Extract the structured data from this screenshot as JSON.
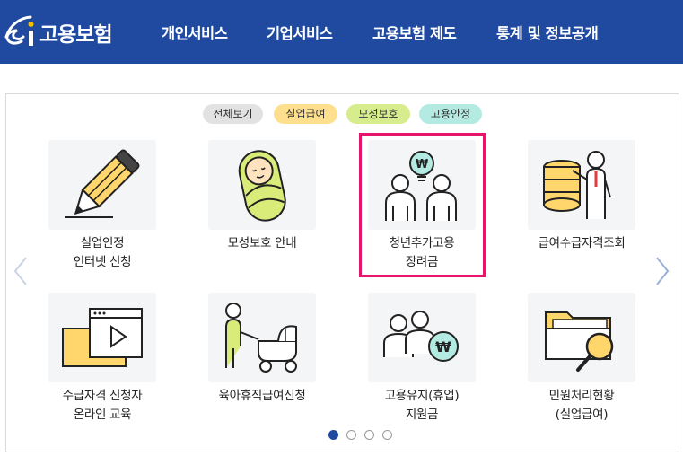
{
  "header": {
    "logo_text": "고용보험",
    "nav": [
      "개인서비스",
      "기업서비스",
      "고용보험 제도",
      "통계 및 정보공개"
    ]
  },
  "filters": [
    {
      "label": "전체보기",
      "color": "#e2e2e2"
    },
    {
      "label": "실업급여",
      "color": "#fddf8d"
    },
    {
      "label": "모성보호",
      "color": "#d6ec8d"
    },
    {
      "label": "고용안정",
      "color": "#b3ebe2"
    }
  ],
  "cards": [
    {
      "line1": "실업인정",
      "line2": "인터넷 신청",
      "icon": "pencil-icon"
    },
    {
      "line1": "모성보호 안내",
      "line2": "",
      "icon": "swaddled-baby-icon"
    },
    {
      "line1": "청년추가고용",
      "line2": "장려금",
      "icon": "two-people-won-bulb-icon"
    },
    {
      "line1": "급여수급자격조회",
      "line2": "",
      "icon": "coins-person-icon"
    },
    {
      "line1": "수급자격 신청자",
      "line2": "온라인 교육",
      "icon": "video-play-icon"
    },
    {
      "line1": "육아휴직급여신청",
      "line2": "",
      "icon": "stroller-parent-icon"
    },
    {
      "line1": "고용유지(휴업)",
      "line2": "지원금",
      "icon": "people-won-coin-icon"
    },
    {
      "line1": "민원처리현황",
      "line2": "(실업급여)",
      "icon": "folder-magnifier-icon"
    }
  ],
  "carousel": {
    "active_page": 1,
    "pages": 4
  },
  "colors": {
    "header_bg": "#1f4aa0",
    "highlight": "#e5156b",
    "dot_active": "#1f4aa0"
  }
}
